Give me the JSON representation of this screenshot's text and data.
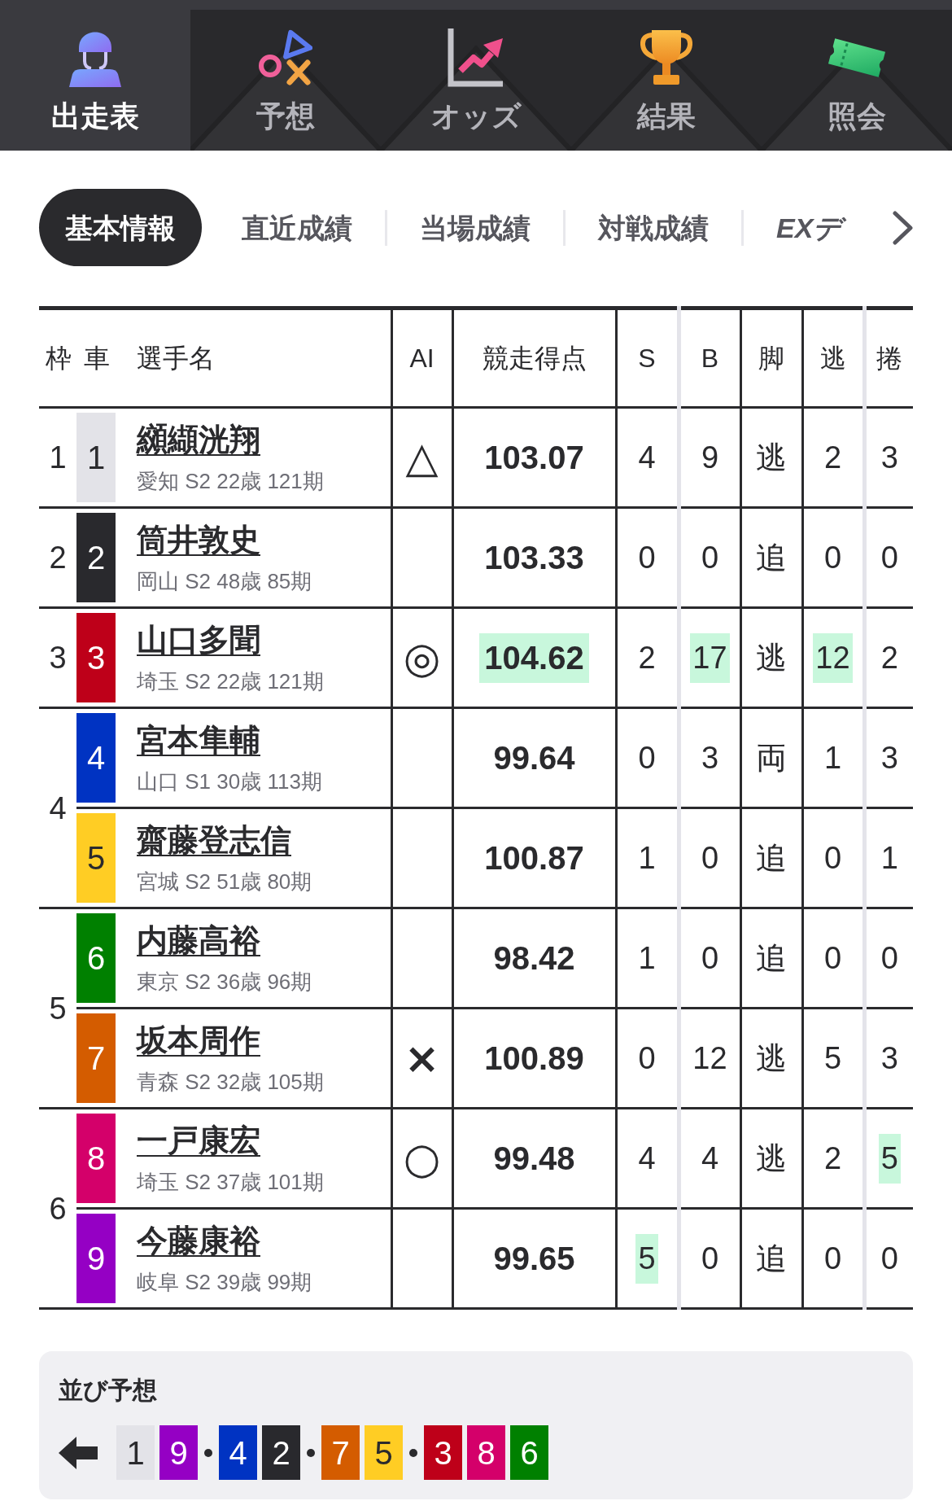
{
  "nav_tabs": [
    {
      "label": "出走表",
      "selected": true
    },
    {
      "label": "予想",
      "selected": false
    },
    {
      "label": "オッズ",
      "selected": false
    },
    {
      "label": "結果",
      "selected": false
    },
    {
      "label": "照会",
      "selected": false
    }
  ],
  "subtabs": [
    {
      "label": "基本情報",
      "selected": true,
      "kind": "standard"
    },
    {
      "label": "直近成績",
      "selected": false,
      "kind": "standard"
    },
    {
      "label": "当場成績",
      "selected": false,
      "kind": "standard"
    },
    {
      "label": "対戦成績",
      "selected": false,
      "kind": "standard"
    },
    {
      "label": "EXデ",
      "selected": false,
      "kind": "ex"
    }
  ],
  "table": {
    "columns": [
      "枠",
      "車",
      "選手名",
      "AI",
      "競走得点",
      "S",
      "B",
      "脚",
      "逃",
      "捲"
    ],
    "frames": [
      {
        "frame": "1",
        "riders": [
          {
            "car": "1",
            "color": "#e3e3e8",
            "name": "纐纈洸翔",
            "info": "愛知 S2 22歳 121期",
            "ai": "△",
            "score": {
              "value": "103.07",
              "highlighted": false
            },
            "stats": [
              {
                "value": "4",
                "highlighted": false
              },
              {
                "value": "9",
                "highlighted": false
              },
              {
                "value": "逃",
                "highlighted": false
              },
              {
                "value": "2",
                "highlighted": false
              },
              {
                "value": "3",
                "highlighted": false
              }
            ]
          }
        ]
      },
      {
        "frame": "2",
        "riders": [
          {
            "car": "2",
            "color": "#29292d",
            "name": "筒井敦史",
            "info": "岡山 S2 48歳 85期",
            "score": {
              "value": "103.33",
              "highlighted": false
            },
            "stats": [
              {
                "value": "0",
                "highlighted": false
              },
              {
                "value": "0",
                "highlighted": false
              },
              {
                "value": "追",
                "highlighted": false
              },
              {
                "value": "0",
                "highlighted": false
              },
              {
                "value": "0",
                "highlighted": false
              }
            ]
          }
        ]
      },
      {
        "frame": "3",
        "riders": [
          {
            "car": "3",
            "color": "#be0019",
            "name": "山口多聞",
            "info": "埼玉 S2 22歳 121期",
            "ai": "◎",
            "score": {
              "value": "104.62",
              "highlighted": true
            },
            "stats": [
              {
                "value": "2",
                "highlighted": false
              },
              {
                "value": "17",
                "highlighted": true
              },
              {
                "value": "逃",
                "highlighted": false
              },
              {
                "value": "12",
                "highlighted": true
              },
              {
                "value": "2",
                "highlighted": false
              }
            ]
          }
        ]
      },
      {
        "frame": "4",
        "riders": [
          {
            "car": "4",
            "color": "#0033c2",
            "name": "宮本隼輔",
            "info": "山口 S1 30歳 113期",
            "score": {
              "value": "99.64",
              "highlighted": false
            },
            "stats": [
              {
                "value": "0",
                "highlighted": false
              },
              {
                "value": "3",
                "highlighted": false
              },
              {
                "value": "両",
                "highlighted": false
              },
              {
                "value": "1",
                "highlighted": false
              },
              {
                "value": "3",
                "highlighted": false
              }
            ]
          },
          {
            "car": "5",
            "color": "#ffcd24",
            "name": "齋藤登志信",
            "info": "宮城 S2 51歳 80期",
            "score": {
              "value": "100.87",
              "highlighted": false
            },
            "stats": [
              {
                "value": "1",
                "highlighted": false
              },
              {
                "value": "0",
                "highlighted": false
              },
              {
                "value": "追",
                "highlighted": false
              },
              {
                "value": "0",
                "highlighted": false
              },
              {
                "value": "1",
                "highlighted": false
              }
            ]
          }
        ]
      },
      {
        "frame": "5",
        "riders": [
          {
            "car": "6",
            "color": "#008000",
            "name": "内藤高裕",
            "info": "東京 S2 36歳 96期",
            "score": {
              "value": "98.42",
              "highlighted": false
            },
            "stats": [
              {
                "value": "1",
                "highlighted": false
              },
              {
                "value": "0",
                "highlighted": false
              },
              {
                "value": "追",
                "highlighted": false
              },
              {
                "value": "0",
                "highlighted": false
              },
              {
                "value": "0",
                "highlighted": false
              }
            ]
          },
          {
            "car": "7",
            "color": "#d45c00",
            "name": "坂本周作",
            "info": "青森 S2 32歳 105期",
            "ai": "×",
            "score": {
              "value": "100.89",
              "highlighted": false
            },
            "stats": [
              {
                "value": "0",
                "highlighted": false
              },
              {
                "value": "12",
                "highlighted": false
              },
              {
                "value": "逃",
                "highlighted": false
              },
              {
                "value": "5",
                "highlighted": false
              },
              {
                "value": "3",
                "highlighted": false
              }
            ]
          }
        ]
      },
      {
        "frame": "6",
        "riders": [
          {
            "car": "8",
            "color": "#d4006a",
            "name": "一戸康宏",
            "info": "埼玉 S2 37歳 101期",
            "ai": "○",
            "score": {
              "value": "99.48",
              "highlighted": false
            },
            "stats": [
              {
                "value": "4",
                "highlighted": false
              },
              {
                "value": "4",
                "highlighted": false
              },
              {
                "value": "逃",
                "highlighted": false
              },
              {
                "value": "2",
                "highlighted": false
              },
              {
                "value": "5",
                "highlighted": true
              }
            ]
          },
          {
            "car": "9",
            "color": "#9500c4",
            "name": "今藤康裕",
            "info": "岐阜 S2 39歳 99期",
            "score": {
              "value": "99.65",
              "highlighted": false
            },
            "stats": [
              {
                "value": "5",
                "highlighted": true
              },
              {
                "value": "0",
                "highlighted": false
              },
              {
                "value": "追",
                "highlighted": false
              },
              {
                "value": "0",
                "highlighted": false
              },
              {
                "value": "0",
                "highlighted": false
              }
            ]
          }
        ]
      }
    ]
  },
  "lineup": {
    "title": "並び予想",
    "groups": [
      {
        "cars": [
          {
            "number": "1",
            "color": "#e3e3e8"
          },
          {
            "number": "9",
            "color": "#9500c4"
          }
        ]
      },
      {
        "cars": [
          {
            "number": "4",
            "color": "#0033c2"
          },
          {
            "number": "2",
            "color": "#29292d"
          }
        ]
      },
      {
        "cars": [
          {
            "number": "7",
            "color": "#d45c00"
          },
          {
            "number": "5",
            "color": "#ffcd24"
          }
        ]
      },
      {
        "cars": [
          {
            "number": "3",
            "color": "#be0019"
          },
          {
            "number": "8",
            "color": "#d4006a"
          },
          {
            "number": "6",
            "color": "#008000"
          }
        ]
      }
    ]
  }
}
